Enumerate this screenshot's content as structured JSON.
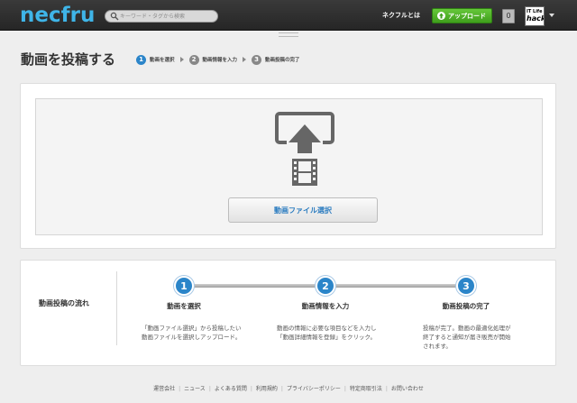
{
  "header": {
    "logo": "necfru",
    "search_placeholder": "キーワード・タグから検索",
    "about_label": "ネクフルとは",
    "upload_label": "アップロード",
    "notification_count": "0",
    "avatar_text_top": "IT Life",
    "avatar_text_bottom": "hack"
  },
  "page": {
    "title": "動画を投稿する",
    "steps": [
      {
        "num": "1",
        "label": "動画を選択"
      },
      {
        "num": "2",
        "label": "動画情報を入力"
      },
      {
        "num": "3",
        "label": "動画投稿の完了"
      }
    ]
  },
  "upload": {
    "button_label": "動画ファイル選択"
  },
  "flow": {
    "title": "動画投稿の流れ",
    "steps": [
      {
        "num": "1",
        "heading": "動画を選択",
        "desc_line1": "「動画ファイル選択」から投稿したい",
        "desc_line2": "動画ファイルを選択しアップロード。",
        "desc_line3": ""
      },
      {
        "num": "2",
        "heading": "動画情報を入力",
        "desc_line1": "動画の情報に必要な項目などを入力し",
        "desc_line2": "「動画詳細情報を登録」をクリック。",
        "desc_line3": ""
      },
      {
        "num": "3",
        "heading": "動画投稿の完了",
        "desc_line1": "投稿が完了。動画の最適化処理が",
        "desc_line2": "終了すると通知が届き販売が開始",
        "desc_line3": "されます。"
      }
    ]
  },
  "footer": {
    "links": [
      "運営会社",
      "ニュース",
      "よくある質問",
      "利用規約",
      "プライバシーポリシー",
      "特定商取引法",
      "お問い合わせ"
    ]
  },
  "colors": {
    "brand": "#3fb5e8",
    "accent_blue": "#2b85c9",
    "upload_green": "#4fb02a"
  }
}
